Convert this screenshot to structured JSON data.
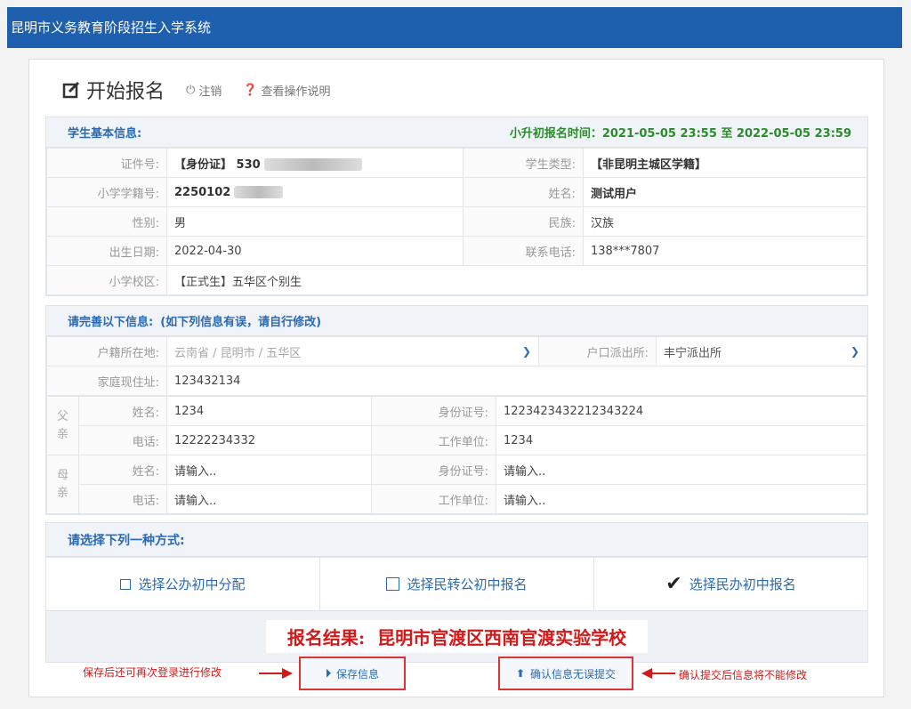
{
  "app_title": "昆明市义务教育阶段招生入学系统",
  "header": {
    "title": "开始报名",
    "logout": "注销",
    "help": "查看操作说明"
  },
  "basic": {
    "heading": "学生基本信息:",
    "period": "小升初报名时间：2021-05-05 23:55 至 2022-05-05 23:59",
    "id_label": "证件号:",
    "id_value": "【身份证】 530",
    "type_label": "学生类型:",
    "type_value": "【非昆明主城区学籍】",
    "school_no_label": "小学学籍号:",
    "school_no_value": "2250102",
    "name_label": "姓名:",
    "name_value": "测试用户",
    "gender_label": "性别:",
    "gender_value": "男",
    "ethnic_label": "民族:",
    "ethnic_value": "汉族",
    "birth_label": "出生日期:",
    "birth_value": "2022-04-30",
    "phone_label": "联系电话:",
    "phone_value": "138***7807",
    "campus_label": "小学校区:",
    "campus_value": "【正式生】五华区个别生"
  },
  "complete": {
    "heading": "请完善以下信息:",
    "hint": "(如下列信息有误，请自行修改)",
    "huji_label": "户籍所在地:",
    "huji_value": "云南省 / 昆明市 / 五华区",
    "police_label": "户口派出所:",
    "police_value": "丰宁派出所",
    "addr_label": "家庭现住址:",
    "addr_value": "123432134",
    "father": "父亲",
    "mother": "母亲",
    "name_label": "姓名:",
    "phone_label": "电话:",
    "idno_label": "身份证号:",
    "work_label": "工作单位:",
    "father_name": "1234",
    "father_id": "1223423432212343224",
    "father_phone": "12222234332",
    "father_work": "1234",
    "placeholder": "请输入.."
  },
  "choose": {
    "heading": "请选择下列一种方式:",
    "opt1": "选择公办初中分配",
    "opt2": "选择民转公初中报名",
    "opt3": "选择民办初中报名"
  },
  "result": {
    "label": "报名结果:",
    "school": "昆明市官渡区西南官渡实验学校"
  },
  "buttons": {
    "save": "保存信息",
    "confirm": "确认信息无误提交"
  },
  "notes": {
    "save_note": "保存后还可再次登录进行修改",
    "confirm_note": "确认提交后信息将不能修改"
  }
}
